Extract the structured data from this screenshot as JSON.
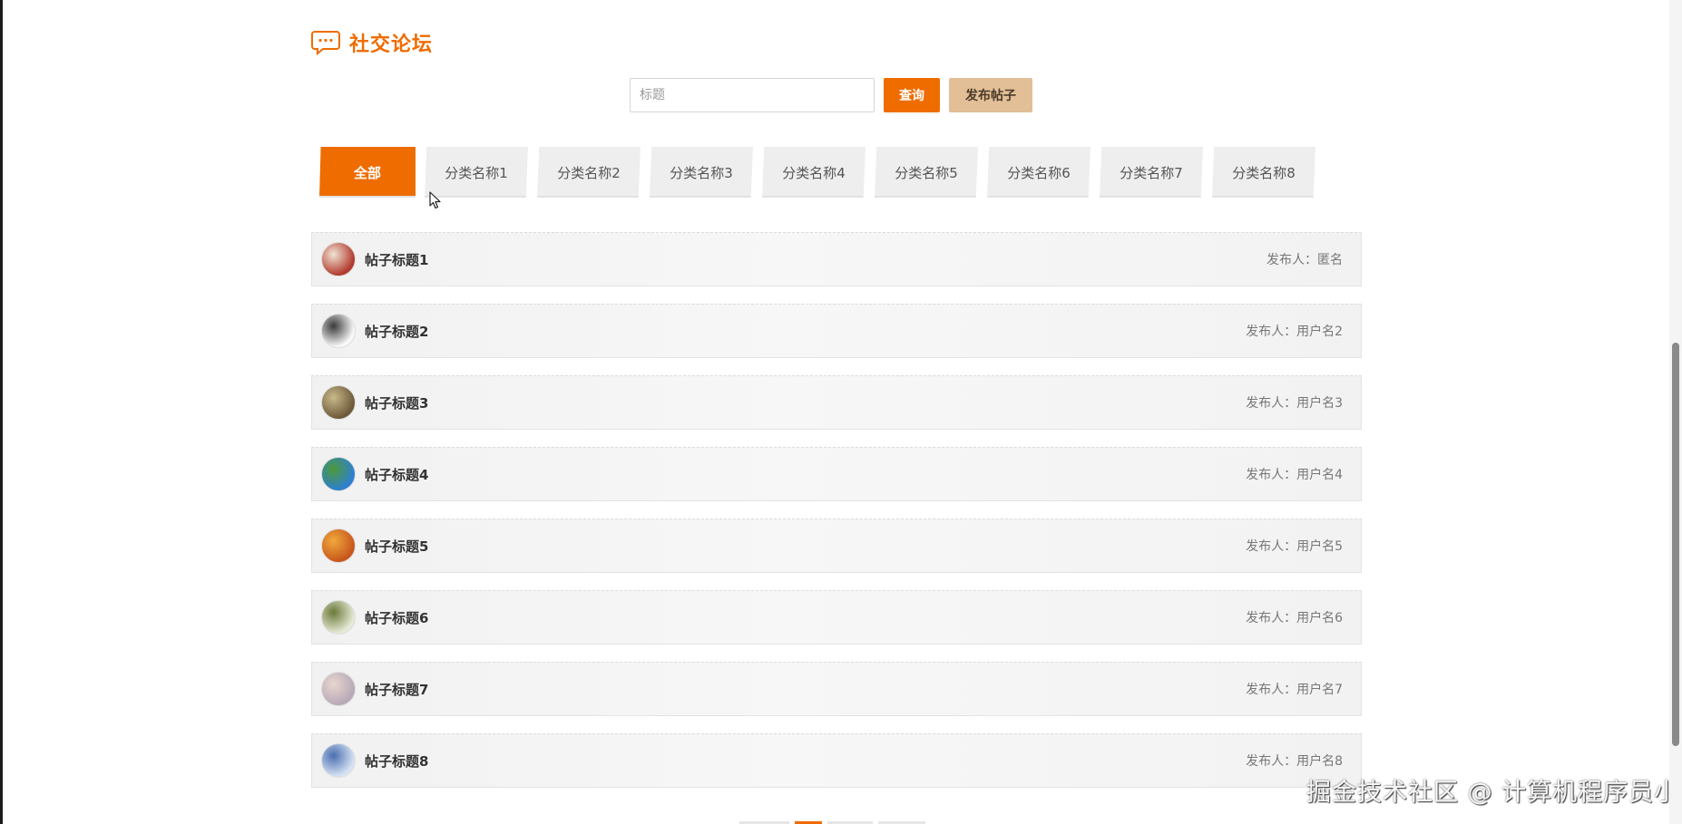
{
  "section": {
    "title": "社交论坛",
    "icon": "chat-bubble-icon",
    "accent_color": "#ef6c00"
  },
  "search": {
    "placeholder": "标题",
    "value": "",
    "query_label": "查询",
    "post_label": "发布帖子"
  },
  "tabs": [
    {
      "label": "全部",
      "active": true
    },
    {
      "label": "分类名称1",
      "active": false
    },
    {
      "label": "分类名称2",
      "active": false
    },
    {
      "label": "分类名称3",
      "active": false
    },
    {
      "label": "分类名称4",
      "active": false
    },
    {
      "label": "分类名称5",
      "active": false
    },
    {
      "label": "分类名称6",
      "active": false
    },
    {
      "label": "分类名称7",
      "active": false
    },
    {
      "label": "分类名称8",
      "active": false
    }
  ],
  "posts": [
    {
      "title": "帖子标题1",
      "author_label": "发布人：",
      "author": "匿名",
      "avatar_colors": [
        "#b23a2e",
        "#f1e3d3"
      ]
    },
    {
      "title": "帖子标题2",
      "author_label": "发布人：",
      "author": "用户名2",
      "avatar_colors": [
        "#fafafa",
        "#3a3a3a"
      ]
    },
    {
      "title": "帖子标题3",
      "author_label": "发布人：",
      "author": "用户名3",
      "avatar_colors": [
        "#6e5a3a",
        "#c9b98a"
      ]
    },
    {
      "title": "帖子标题4",
      "author_label": "发布人：",
      "author": "用户名4",
      "avatar_colors": [
        "#2f7fd1",
        "#4c9a3a"
      ]
    },
    {
      "title": "帖子标题5",
      "author_label": "发布人：",
      "author": "用户名5",
      "avatar_colors": [
        "#c8561c",
        "#f0a93b"
      ]
    },
    {
      "title": "帖子标题6",
      "author_label": "发布人：",
      "author": "用户名6",
      "avatar_colors": [
        "#e6ead6",
        "#6b7a3a"
      ]
    },
    {
      "title": "帖子标题7",
      "author_label": "发布人：",
      "author": "用户名7",
      "avatar_colors": [
        "#b8a9b7",
        "#e8d6cf"
      ]
    },
    {
      "title": "帖子标题8",
      "author_label": "发布人：",
      "author": "用户名8",
      "avatar_colors": [
        "#d7e3f4",
        "#4a6fb0"
      ]
    }
  ],
  "watermark": "掘金技术社区 @ 计算机程序员小杨"
}
